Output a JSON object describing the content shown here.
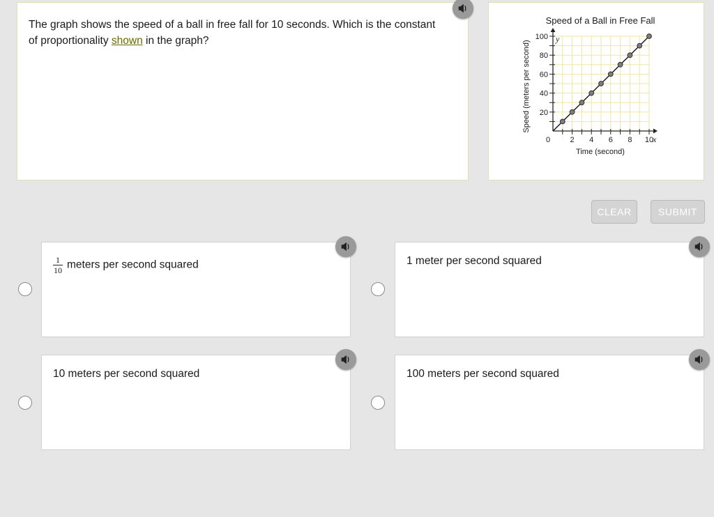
{
  "question": {
    "part1": "The graph shows the speed of a ball in free fall for 10 seconds. Which is the constant of proportionality ",
    "highlight": "shown",
    "part2": " in the graph?"
  },
  "graph": {
    "title": "Speed of a Ball in Free Fall"
  },
  "chart_data": {
    "type": "scatter",
    "title": "Speed of a Ball in Free Fall",
    "xlabel": "Time (second)",
    "ylabel": "Speed (meters per second)",
    "x_axis_symbol": "x",
    "y_axis_symbol": "y",
    "xlim": [
      0,
      10
    ],
    "ylim": [
      0,
      100
    ],
    "x_ticks": [
      "2",
      "4",
      "6",
      "8",
      "10"
    ],
    "y_ticks": [
      "20",
      "40",
      "60",
      "80",
      "100"
    ],
    "origin_label": "0",
    "grid": true,
    "connected": true,
    "points": [
      {
        "x": 1,
        "y": 10
      },
      {
        "x": 2,
        "y": 20
      },
      {
        "x": 3,
        "y": 30
      },
      {
        "x": 4,
        "y": 40
      },
      {
        "x": 5,
        "y": 50
      },
      {
        "x": 6,
        "y": 60
      },
      {
        "x": 7,
        "y": 70
      },
      {
        "x": 8,
        "y": 80
      },
      {
        "x": 9,
        "y": 90
      },
      {
        "x": 10,
        "y": 100
      }
    ]
  },
  "buttons": {
    "clear": "CLEAR",
    "submit": "SUBMIT"
  },
  "choices": [
    {
      "numerator": "1",
      "denominator": "10",
      "label": "meters per second squared"
    },
    {
      "label": "1 meter per second squared"
    },
    {
      "label": "10 meters per second squared"
    },
    {
      "label": "100 meters per second squared"
    }
  ],
  "colors": {
    "background": "#e6e6e6",
    "panel_border": "#e2dfb5",
    "grid_line": "#f0e6a6",
    "button_disabled": "#d4d4d4",
    "speaker": "#9a9a9a"
  },
  "icons": {
    "speaker": "speaker-icon",
    "radio": "radio-button"
  }
}
